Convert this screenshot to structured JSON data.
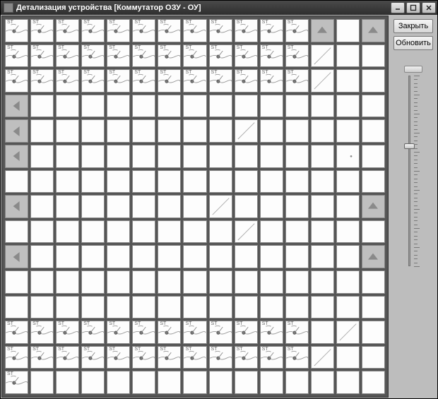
{
  "window": {
    "title": "Детализация устройства [Коммутатор ОЗУ - ОУ]"
  },
  "buttons": {
    "close": "Закрыть",
    "refresh": "Обновить"
  },
  "grid": {
    "rows": 15,
    "cols": 15,
    "cell_label": "ST",
    "cells": [
      [
        "st",
        "st",
        "st",
        "st",
        "st",
        "st",
        "st",
        "st",
        "st",
        "st",
        "st",
        "st",
        "up",
        "blank",
        "up"
      ],
      [
        "st",
        "st",
        "st",
        "st",
        "st",
        "st",
        "st",
        "st",
        "st",
        "st",
        "st",
        "st",
        "diag",
        "blank",
        "blank"
      ],
      [
        "st",
        "st",
        "st",
        "st",
        "st",
        "st",
        "st",
        "st",
        "st",
        "st",
        "st",
        "st",
        "diag",
        "blank",
        "blank"
      ],
      [
        "left",
        "blank",
        "blank",
        "blank",
        "blank",
        "blank",
        "blank",
        "blank",
        "blank",
        "blank",
        "blank",
        "blank",
        "blank",
        "blank",
        "blank"
      ],
      [
        "left",
        "blank",
        "blank",
        "blank",
        "blank",
        "blank",
        "blank",
        "blank",
        "blank",
        "diag",
        "blank",
        "blank",
        "blank",
        "blank",
        "blank"
      ],
      [
        "left",
        "blank",
        "blank",
        "blank",
        "blank",
        "blank",
        "blank",
        "blank",
        "blank",
        "blank",
        "blank",
        "blank",
        "blank",
        "dot",
        "blank"
      ],
      [
        "blank",
        "blank",
        "blank",
        "blank",
        "blank",
        "blank",
        "blank",
        "blank",
        "blank",
        "blank",
        "blank",
        "blank",
        "blank",
        "blank",
        "blank"
      ],
      [
        "left",
        "blank",
        "blank",
        "blank",
        "blank",
        "blank",
        "blank",
        "blank",
        "diag",
        "blank",
        "blank",
        "blank",
        "blank",
        "blank",
        "up"
      ],
      [
        "blank",
        "blank",
        "blank",
        "blank",
        "blank",
        "blank",
        "blank",
        "blank",
        "blank",
        "diag",
        "blank",
        "blank",
        "blank",
        "blank",
        "blank"
      ],
      [
        "left",
        "blank",
        "blank",
        "blank",
        "blank",
        "blank",
        "blank",
        "blank",
        "blank",
        "blank",
        "blank",
        "blank",
        "blank",
        "blank",
        "up"
      ],
      [
        "blank",
        "blank",
        "blank",
        "blank",
        "blank",
        "blank",
        "blank",
        "blank",
        "blank",
        "blank",
        "blank",
        "blank",
        "blank",
        "blank",
        "blank"
      ],
      [
        "blank",
        "blank",
        "blank",
        "blank",
        "blank",
        "blank",
        "blank",
        "blank",
        "blank",
        "blank",
        "blank",
        "blank",
        "blank",
        "blank",
        "blank"
      ],
      [
        "st",
        "st",
        "st",
        "st",
        "st",
        "st",
        "st",
        "st",
        "st",
        "st",
        "st",
        "st",
        "blank",
        "diag",
        "blank"
      ],
      [
        "st",
        "st",
        "st",
        "st",
        "st",
        "st",
        "st",
        "st",
        "st",
        "st",
        "st",
        "st",
        "diag",
        "blank",
        "blank"
      ],
      [
        "st",
        "blank",
        "blank",
        "blank",
        "blank",
        "blank",
        "blank",
        "blank",
        "blank",
        "blank",
        "blank",
        "blank",
        "blank",
        "blank",
        "blank"
      ]
    ]
  },
  "slider": {
    "min": 0,
    "max": 100,
    "value": 37,
    "tick_count": 50
  }
}
